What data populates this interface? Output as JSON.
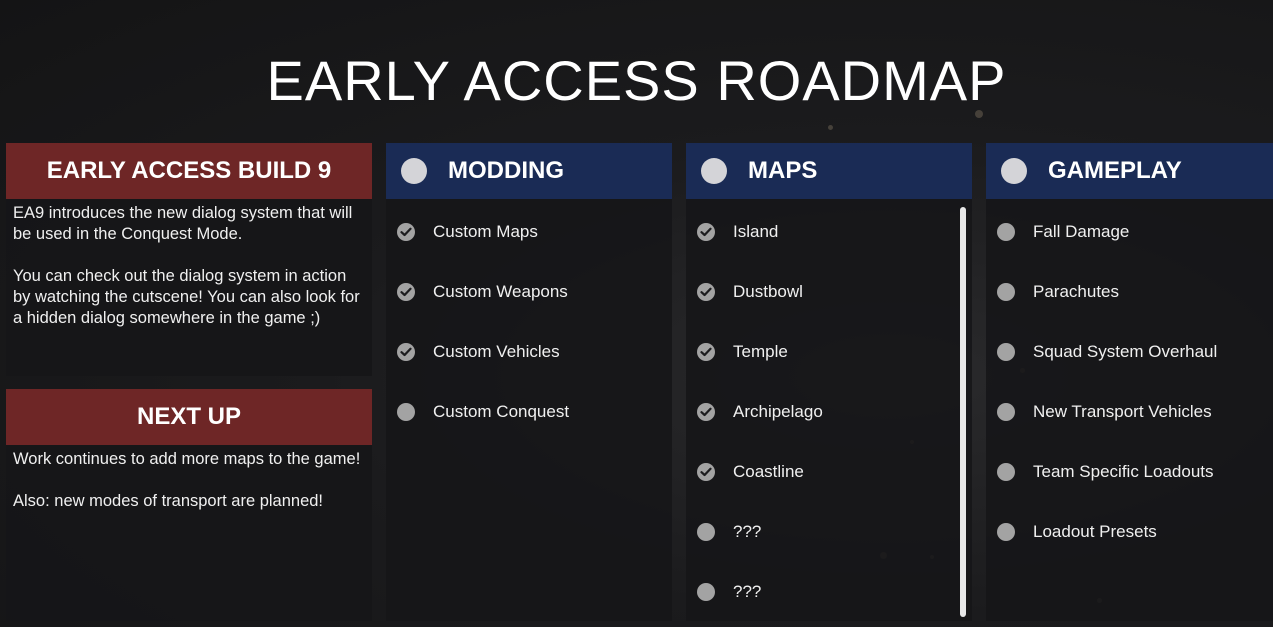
{
  "title": "EARLY ACCESS ROADMAP",
  "build": {
    "header": "EARLY ACCESS BUILD 9",
    "text": "EA9 introduces the new dialog system that will be used in the Conquest Mode.\n\nYou can check out the dialog system in action by watching the cutscene! You can also look for a hidden dialog somewhere in the game ;)"
  },
  "next_up": {
    "header": "NEXT UP",
    "text": "Work continues to add more maps to the game!\n\nAlso: new modes of transport are planned!"
  },
  "columns": [
    {
      "header": "MODDING",
      "items": [
        {
          "label": "Custom Maps",
          "done": true
        },
        {
          "label": "Custom Weapons",
          "done": true
        },
        {
          "label": "Custom Vehicles",
          "done": true
        },
        {
          "label": "Custom Conquest",
          "done": false
        }
      ]
    },
    {
      "header": "MAPS",
      "items": [
        {
          "label": "Island",
          "done": true
        },
        {
          "label": "Dustbowl",
          "done": true
        },
        {
          "label": "Temple",
          "done": true
        },
        {
          "label": "Archipelago",
          "done": true
        },
        {
          "label": "Coastline",
          "done": true
        },
        {
          "label": "???",
          "done": false
        },
        {
          "label": "???",
          "done": false
        }
      ]
    },
    {
      "header": "GAMEPLAY",
      "items": [
        {
          "label": "Fall Damage",
          "done": false
        },
        {
          "label": "Parachutes",
          "done": false
        },
        {
          "label": "Squad System Overhaul",
          "done": false
        },
        {
          "label": "New Transport Vehicles",
          "done": false
        },
        {
          "label": "Team Specific Loadouts",
          "done": false
        },
        {
          "label": "Loadout Presets",
          "done": false
        }
      ]
    }
  ],
  "icons": {
    "header_marker": "circle-icon",
    "done_marker": "check-circle-icon",
    "pending_marker": "circle-icon"
  },
  "colors": {
    "red_header": "#6e2626",
    "blue_header": "#1a2b55",
    "panel": "#161618",
    "marker": "#a3a3a3"
  }
}
